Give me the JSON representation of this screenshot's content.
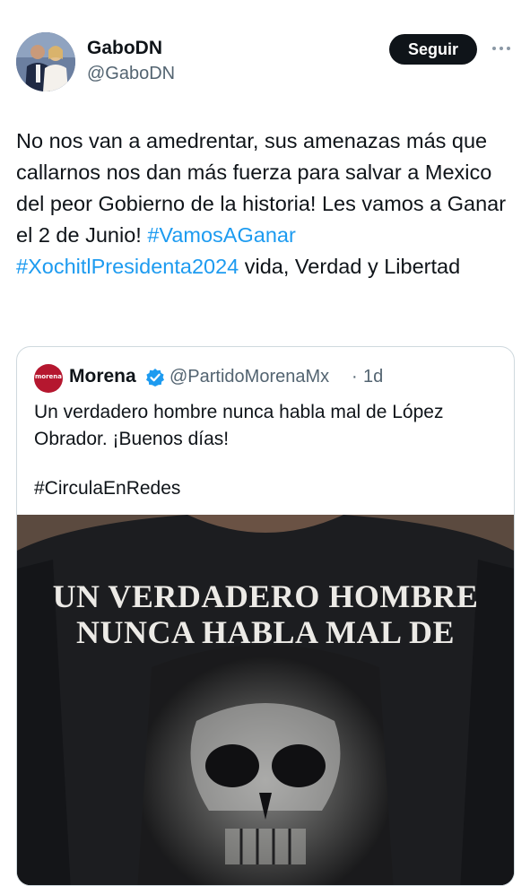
{
  "author": {
    "display_name": "GaboDN",
    "handle": "@GaboDN"
  },
  "actions": {
    "follow_label": "Seguir",
    "more_icon": "more-horizontal-icon"
  },
  "tweet": {
    "text_part1": "No nos van a amedrentar, sus amenazas más que callarnos nos dan más fuerza para salvar a Mexico  del peor Gobierno de la historia! Les vamos a Ganar el 2 de Junio! ",
    "hashtag1": "#VamosAGanar",
    "hashtag2": "#XochitlPresidenta2024",
    "text_part2": " vida, Verdad y Libertad"
  },
  "quoted": {
    "avatar_label": "morena",
    "display_name": "Morena",
    "handle": "@PartidoMorenaMx",
    "separator": "·",
    "time": "1d",
    "text": "Un verdadero hombre nunca habla mal de López Obrador. ¡Buenos días!",
    "hashtag": "#CirculaEnRedes",
    "image": {
      "line1": "UN VERDADERO HOMBRE",
      "line2": "NUNCA HABLA MAL DE"
    }
  },
  "colors": {
    "link": "#1d9bf0",
    "secondary_text": "#536471",
    "verified_badge": "#1d9bf0",
    "morena_brand": "#b5172f"
  }
}
